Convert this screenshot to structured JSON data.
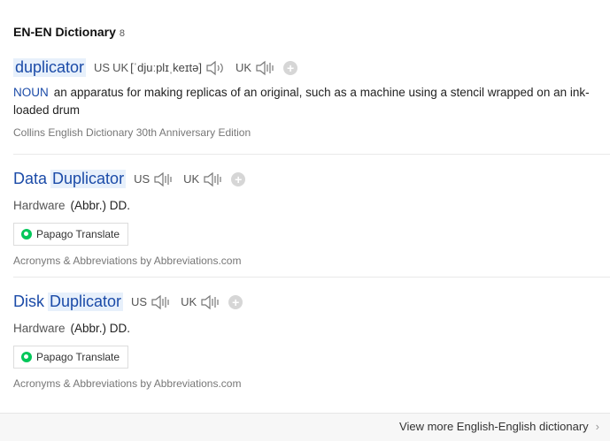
{
  "header": {
    "title": "EN-EN Dictionary",
    "count": "8"
  },
  "entries": [
    {
      "word": "duplicator",
      "us_label": "US",
      "uk_label_inline": "UK",
      "phonetic": "[ˈdjuːplɪˌkeɪtə]",
      "uk_label": "UK",
      "pos": "NOUN",
      "definition": "an apparatus for making replicas of an original, such as a machine using a stencil wrapped on an ink-loaded drum",
      "source": "Collins English Dictionary 30th Anniversary Edition"
    },
    {
      "word_prefix": "Data",
      "word_highlight": "Duplicator",
      "us_label": "US",
      "uk_label": "UK",
      "pos": "Hardware",
      "definition": "(Abbr.) DD.",
      "translate_button": "Papago Translate",
      "source": "Acronyms & Abbreviations by Abbreviations.com"
    },
    {
      "word_prefix": "Disk",
      "word_highlight": "Duplicator",
      "us_label": "US",
      "uk_label": "UK",
      "pos": "Hardware",
      "definition": "(Abbr.) DD.",
      "translate_button": "Papago Translate",
      "source": "Acronyms & Abbreviations by Abbreviations.com"
    }
  ],
  "footer": {
    "link": "View more English-English dictionary"
  },
  "icons": {
    "speaker": "speaker-icon",
    "plus": "add-wordbook-icon",
    "chevron": "chevron-right-icon",
    "papago": "papago-logo-icon"
  },
  "colors": {
    "word": "#1b4ba8",
    "highlight": "#e7f0fb",
    "papago": "#03c75a"
  }
}
